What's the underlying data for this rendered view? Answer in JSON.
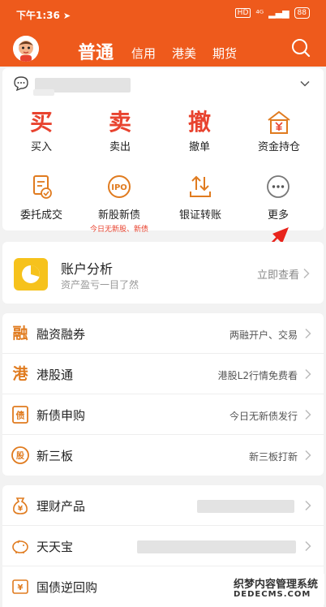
{
  "status_bar": {
    "time": "下午1:36",
    "hd": "HD",
    "signal": "⁴ᴳ",
    "battery": "88"
  },
  "header": {
    "tabs": [
      {
        "label": "普通",
        "active": true
      },
      {
        "label": "信用",
        "active": false
      },
      {
        "label": "港美",
        "active": false
      },
      {
        "label": "期货",
        "active": false
      }
    ],
    "accent_color": "#ee5a1c"
  },
  "actions": [
    {
      "glyph": "买",
      "label": "买入"
    },
    {
      "glyph": "卖",
      "label": "卖出"
    },
    {
      "glyph": "撤",
      "label": "撤单"
    },
    {
      "label": "资金持仓",
      "icon": "wallet-yen-icon"
    }
  ],
  "tools": [
    {
      "label": "委托成交",
      "icon": "order-check-icon"
    },
    {
      "label": "新股新债",
      "icon": "ipo-icon",
      "sub": "今日无新股、新债"
    },
    {
      "label": "银证转账",
      "icon": "transfer-icon"
    },
    {
      "label": "更多",
      "icon": "more-icon"
    }
  ],
  "analysis": {
    "title": "账户分析",
    "subtitle": "资产盈亏一目了然",
    "action": "立即查看"
  },
  "list1": [
    {
      "icon_char": "融",
      "title": "融资融券",
      "right": "两融开户、交易"
    },
    {
      "icon_char": "港",
      "title": "港股通",
      "right": "港股L2行情免费看"
    },
    {
      "icon_char": "债",
      "title": "新债申购",
      "right": "今日无新债发行"
    },
    {
      "icon_char": "股",
      "title": "新三板",
      "right": "新三板打新"
    }
  ],
  "list2": [
    {
      "icon_char": "¥",
      "title": "理财产品"
    },
    {
      "icon_char": "◡",
      "title": "天天宝"
    },
    {
      "icon_char": "¥",
      "title": "国债逆回购"
    }
  ],
  "watermark": {
    "line1": "织梦内容管理系统",
    "line2": "DEDECMS.COM"
  }
}
